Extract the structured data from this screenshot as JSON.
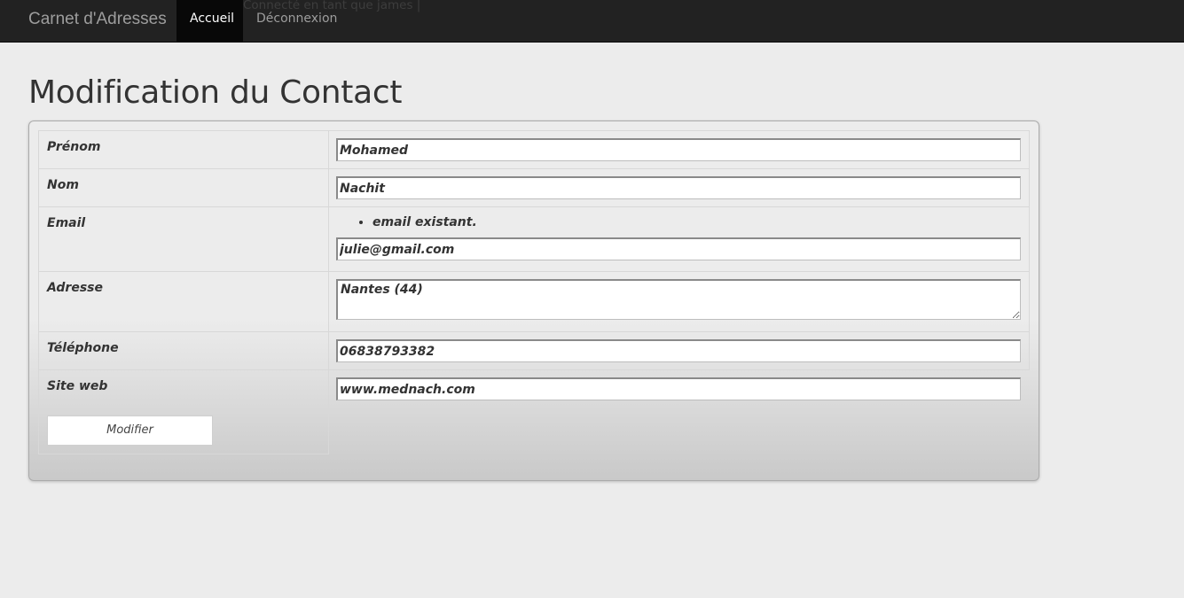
{
  "navbar": {
    "brand": "Carnet d'Adresses",
    "active_item": "Accueil",
    "logged_in_text": "Connecté en tant que james |",
    "logout": "Déconnexion"
  },
  "page": {
    "title": "Modification du Contact"
  },
  "form": {
    "prenom": {
      "label": "Prénom",
      "value": "Mohamed"
    },
    "nom": {
      "label": "Nom",
      "value": "Nachit"
    },
    "email": {
      "label": "Email",
      "error": "email existant.",
      "value": "julie@gmail.com"
    },
    "adresse": {
      "label": "Adresse",
      "value": "Nantes (44)"
    },
    "telephone": {
      "label": "Téléphone",
      "value": "06838793382"
    },
    "site_web": {
      "label": "Site web",
      "value": "www.mednach.com"
    },
    "submit_label": "Modifier"
  }
}
